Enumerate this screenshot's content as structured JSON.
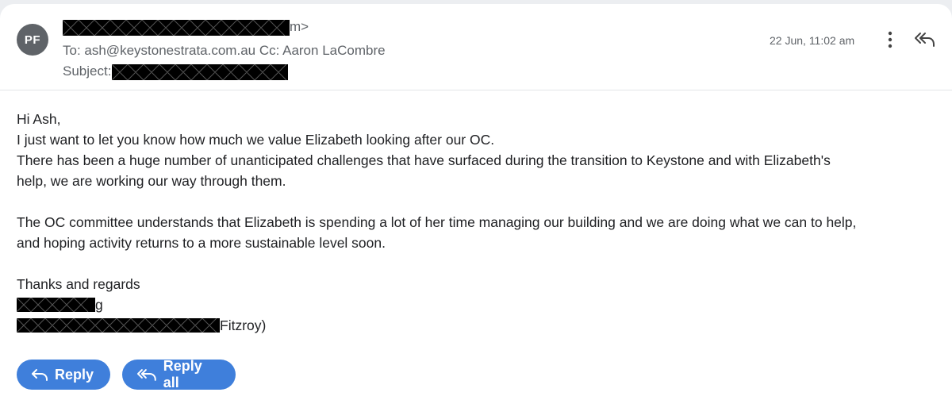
{
  "sender": {
    "avatar_initials": "PF",
    "from_suffix": "m>"
  },
  "recipients": {
    "to_line": "To: ash@keystonestrata.com.au Cc: Aaron LaCombre"
  },
  "subject": {
    "label": "Subject:"
  },
  "meta": {
    "date": "22 Jun, 11:02 am"
  },
  "message": {
    "greeting": "Hi Ash,",
    "line1": "I just want to let you know how much we value Elizabeth looking after our OC.",
    "line2": "There has been a huge number of unanticipated challenges that have surfaced during the transition to Keystone and with Elizabeth's",
    "line3": "help, we are working our way through them.",
    "line4": "The OC committee understands that Elizabeth is spending a lot of her time managing our building and we are doing what we can to help,",
    "line5": "and hoping activity returns to a more sustainable level soon.",
    "signoff": "Thanks and regards",
    "sig_name_suffix": "g",
    "sig_org_suffix": "Fitzroy)"
  },
  "actions": {
    "reply_label": "Reply",
    "reply_all_label": "Reply all"
  },
  "colors": {
    "button_bg": "#3f7fdb",
    "avatar_bg": "#5f6368",
    "meta_text": "#5f6368"
  },
  "icons": {
    "more": "more-vert-icon",
    "reply_all": "reply-all-icon",
    "reply": "reply-icon"
  }
}
